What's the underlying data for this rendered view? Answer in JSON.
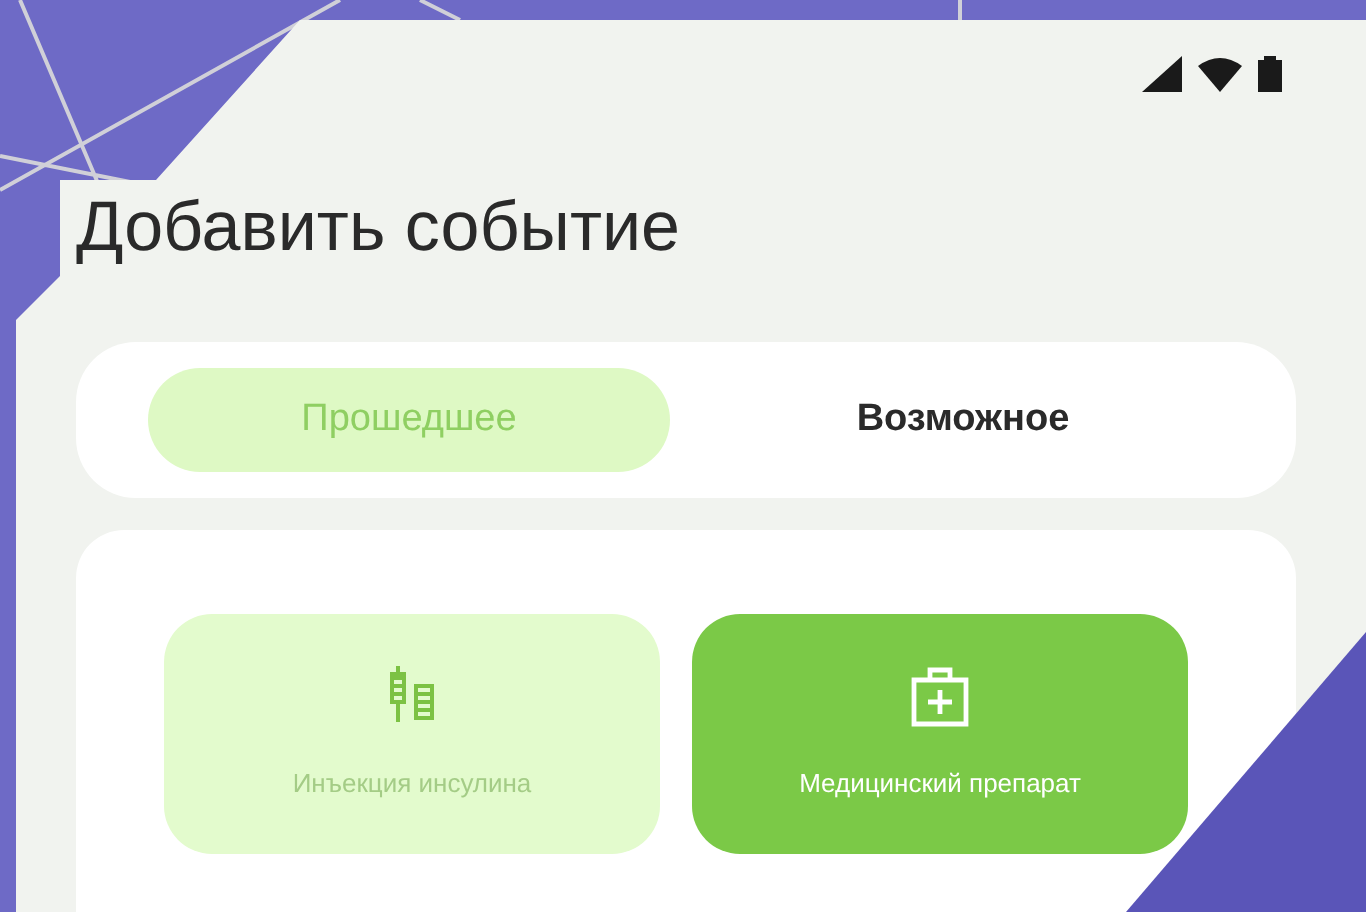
{
  "title": "Добавить событие",
  "tabs": [
    {
      "label": "Прошедшее",
      "selected": true
    },
    {
      "label": "Возможное",
      "selected": false
    }
  ],
  "event_types": [
    {
      "kind": "syringe",
      "label": "Инъекция инсулина",
      "selected": false
    },
    {
      "kind": "medkit",
      "label": "Медицинский препарат",
      "selected": true
    }
  ]
}
